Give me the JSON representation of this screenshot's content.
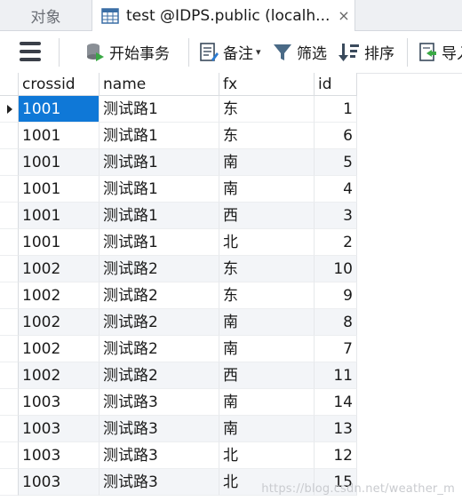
{
  "tabs": [
    {
      "label": "对象",
      "active": false
    },
    {
      "label": "test @IDPS.public (localh...",
      "active": true,
      "close": "×"
    }
  ],
  "toolbar": {
    "begin_transaction": "开始事务",
    "memo": "备注",
    "filter": "筛选",
    "sort": "排序",
    "import": "导入"
  },
  "table": {
    "columns": [
      "crossid",
      "name",
      "fx",
      "id"
    ],
    "rows": [
      [
        "1001",
        "测试路1",
        "东",
        "1"
      ],
      [
        "1001",
        "测试路1",
        "东",
        "6"
      ],
      [
        "1001",
        "测试路1",
        "南",
        "5"
      ],
      [
        "1001",
        "测试路1",
        "南",
        "4"
      ],
      [
        "1001",
        "测试路1",
        "西",
        "3"
      ],
      [
        "1001",
        "测试路1",
        "北",
        "2"
      ],
      [
        "1002",
        "测试路2",
        "东",
        "10"
      ],
      [
        "1002",
        "测试路2",
        "东",
        "9"
      ],
      [
        "1002",
        "测试路2",
        "南",
        "8"
      ],
      [
        "1002",
        "测试路2",
        "南",
        "7"
      ],
      [
        "1002",
        "测试路2",
        "西",
        "11"
      ],
      [
        "1003",
        "测试路3",
        "南",
        "14"
      ],
      [
        "1003",
        "测试路3",
        "南",
        "13"
      ],
      [
        "1003",
        "测试路3",
        "北",
        "12"
      ],
      [
        "1003",
        "测试路3",
        "北",
        "15"
      ]
    ]
  },
  "watermark": "https://blog.csdn.net/weather_m",
  "colors": {
    "selection": "#0f78d7",
    "row_alt": "#f3f5f8"
  }
}
